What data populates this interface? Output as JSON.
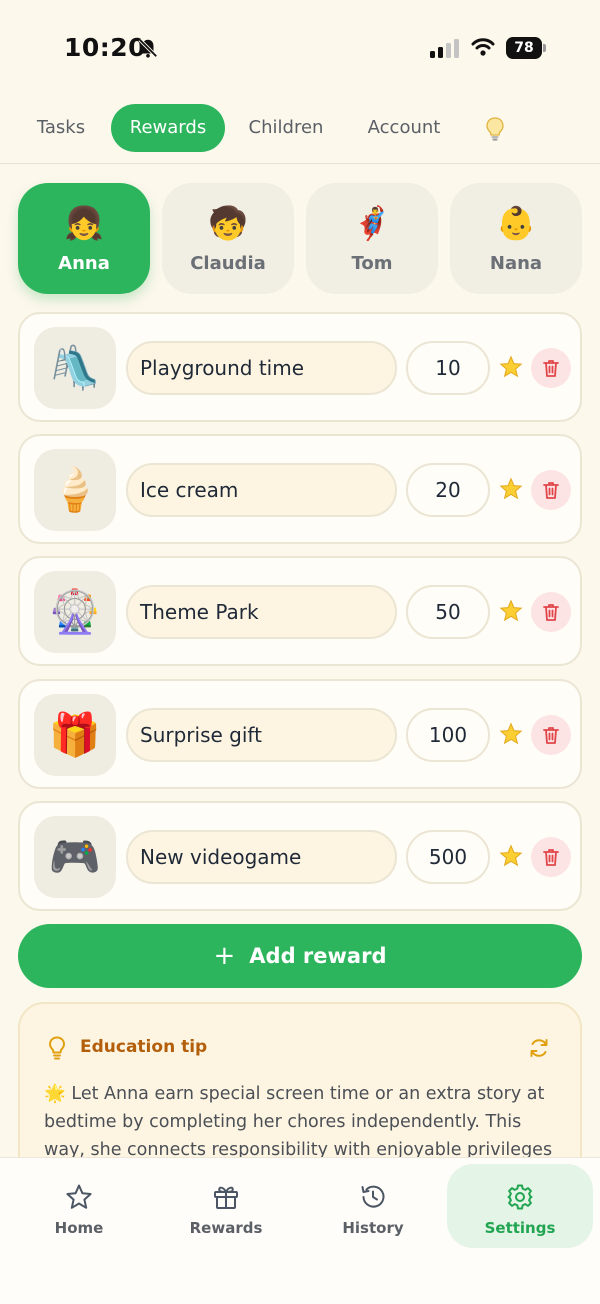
{
  "status_bar": {
    "time": "10:20",
    "battery": "78",
    "icons": [
      "bell-off-icon",
      "signal-icon",
      "wifi-icon",
      "battery-icon"
    ]
  },
  "top_tabs": [
    {
      "label": "Tasks",
      "active": false
    },
    {
      "label": "Rewards",
      "active": true
    },
    {
      "label": "Children",
      "active": false
    },
    {
      "label": "Account",
      "active": false
    }
  ],
  "top_tip_icon": "lightbulb-icon",
  "children": [
    {
      "name": "Anna",
      "emoji": "👧",
      "active": true
    },
    {
      "name": "Claudia",
      "emoji": "🧒",
      "active": false
    },
    {
      "name": "Tom",
      "emoji": "🦸‍♂️",
      "active": false
    },
    {
      "name": "Nana",
      "emoji": "👶",
      "active": false
    }
  ],
  "rewards": [
    {
      "icon": "🛝",
      "name": "Playground time",
      "points": "10"
    },
    {
      "icon": "🍦",
      "name": "Ice cream",
      "points": "20"
    },
    {
      "icon": "🎡",
      "name": "Theme Park",
      "points": "50"
    },
    {
      "icon": "🎁",
      "name": "Surprise gift",
      "points": "100"
    },
    {
      "icon": "🎮",
      "name": "New videogame",
      "points": "500"
    }
  ],
  "add_reward_label": "Add reward",
  "education_tip": {
    "title": "Education tip",
    "emoji": "🌟",
    "text": "Let Anna earn special screen time or an extra story at bedtime by completing her chores independently. This way, she connects responsibility with enjoyable privileges"
  },
  "bottom_nav": [
    {
      "label": "Home",
      "icon": "star-icon",
      "active": false
    },
    {
      "label": "Rewards",
      "icon": "gift-icon",
      "active": false
    },
    {
      "label": "History",
      "icon": "history-icon",
      "active": false
    },
    {
      "label": "Settings",
      "icon": "gear-icon",
      "active": true
    }
  ],
  "colors": {
    "background": "#fdf8ec",
    "accent_green": "#2db55d",
    "tip_title": "#b35e0a",
    "delete_bg": "#fde4e4",
    "delete_icon": "#e0464a"
  }
}
